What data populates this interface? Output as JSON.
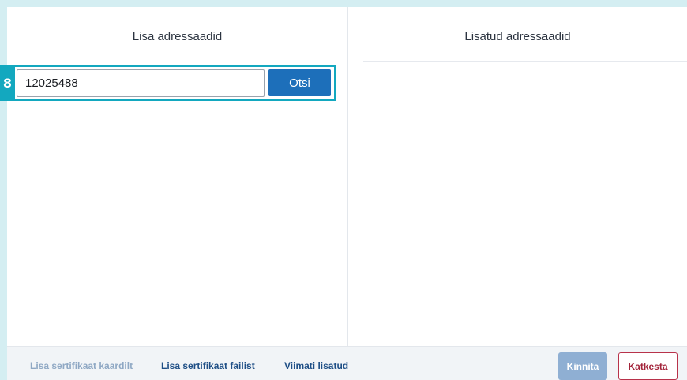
{
  "left_panel": {
    "title": "Lisa adressaadid",
    "step_number": "8",
    "search": {
      "value": "12025488",
      "button_label": "Otsi"
    }
  },
  "right_panel": {
    "title": "Lisatud adressaadid"
  },
  "footer": {
    "links": [
      {
        "label": "Lisa sertifikaat kaardilt",
        "state": "disabled"
      },
      {
        "label": "Lisa sertifikaat failist",
        "state": "active"
      },
      {
        "label": "Viimati lisatud",
        "state": "active"
      }
    ],
    "confirm_label": "Kinnita",
    "cancel_label": "Katkesta"
  },
  "colors": {
    "accent": "#13a8bf",
    "primary": "#1d6fba",
    "danger": "#a3243a"
  }
}
